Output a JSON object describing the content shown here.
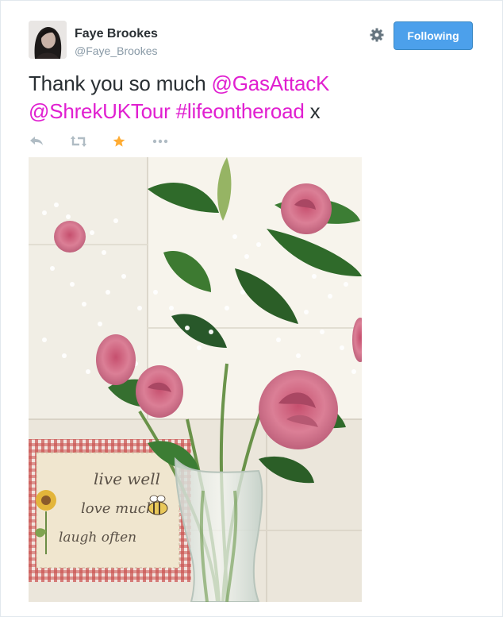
{
  "author": {
    "name": "Faye Brookes",
    "handle": "@Faye_Brookes"
  },
  "follow_button": {
    "label": "Following"
  },
  "tweet": {
    "text_plain_1": "Thank you so much ",
    "mention_1": "@GasAttacK",
    "mention_2": "@ShrekUKTour",
    "space": " ",
    "hashtag": "#lifeontheroad",
    "text_plain_2": " x"
  },
  "actions": {
    "reply_icon": "reply-icon",
    "retweet_icon": "retweet-icon",
    "favorite_icon": "star-icon",
    "more_icon": "more-icon"
  },
  "photo": {
    "sign_line_1": "live well",
    "sign_line_2": "love much",
    "sign_line_3": "laugh often"
  },
  "colors": {
    "link": "#e01fd0",
    "follow_button": "#4ca0eb",
    "favorite_active": "#ffac33",
    "muted": "#8899a6"
  }
}
